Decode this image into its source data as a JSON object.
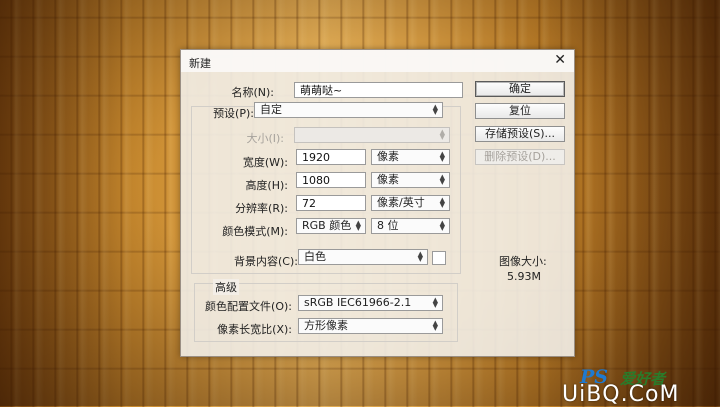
{
  "dialog": {
    "title": "新建",
    "close_glyph": "✕",
    "name_label": "名称(N):",
    "name_value": "萌萌哒~",
    "preset_label": "预设(P):",
    "preset_value": "自定",
    "size_label": "大小(I):",
    "size_value": "",
    "width_label": "宽度(W):",
    "width_value": "1920",
    "width_unit": "像素",
    "height_label": "高度(H):",
    "height_value": "1080",
    "height_unit": "像素",
    "resolution_label": "分辨率(R):",
    "resolution_value": "72",
    "resolution_unit": "像素/英寸",
    "color_mode_label": "颜色模式(M):",
    "color_mode_value": "RGB 颜色",
    "bit_depth_value": "8 位",
    "background_label": "背景内容(C):",
    "background_value": "白色",
    "advanced_label": "高级",
    "color_profile_label": "颜色配置文件(O):",
    "color_profile_value": "sRGB IEC61966-2.1",
    "pixel_aspect_label": "像素长宽比(X):",
    "pixel_aspect_value": "方形像素",
    "buttons": {
      "ok": "确定",
      "reset": "复位",
      "save_preset": "存储预设(S)...",
      "delete_preset": "删除预设(D)..."
    },
    "image_size_label": "图像大小:",
    "image_size_value": "5.93M"
  },
  "watermark": {
    "ps": "PS",
    "cn": "爱好者",
    "site": "UiBQ.CoM"
  },
  "colors": {
    "background_wood": "#c98a2e",
    "dialog_bg": "#f2eee8"
  }
}
